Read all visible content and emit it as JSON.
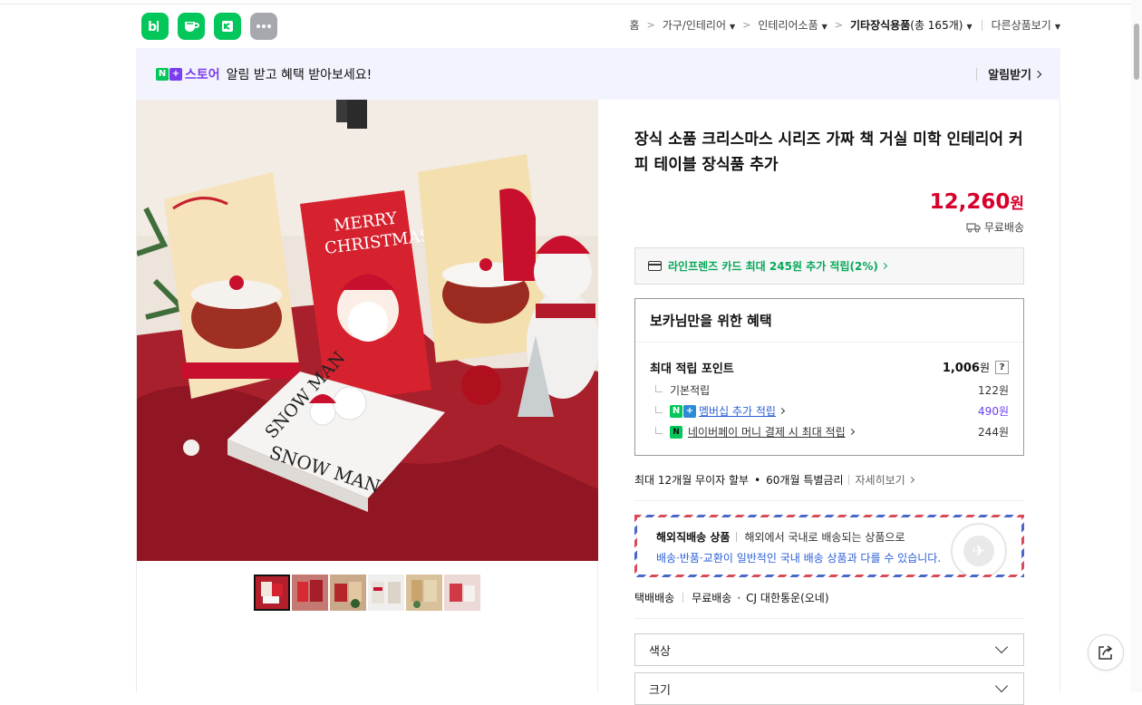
{
  "apps": [
    {
      "name": "blog",
      "label": "b|",
      "color": "#03c75a"
    },
    {
      "name": "cafe",
      "label": "",
      "color": "#03c75a"
    },
    {
      "name": "news",
      "label": "",
      "color": "#03c75a"
    },
    {
      "name": "more",
      "label": "···",
      "color": "#a6a8ae"
    }
  ],
  "breadcrumb": {
    "home": "홈",
    "c1": "가구/인테리어",
    "c2": "인테리어소품",
    "c3": "기타장식용품",
    "c3_count": "(총 165개)",
    "other": "다른상품보기"
  },
  "banner": {
    "store": "스토어",
    "message": "알림 받고 혜택 받아보세요!",
    "action": "알림받기"
  },
  "product": {
    "title": "장식 소품 크리스마스 시리즈 가짜 책 거실 미학 인테리어 커피 테이블 장식품 추가",
    "price": "12,260",
    "currency": "원",
    "shipping": "무료배송"
  },
  "card_benefit": "라인프렌즈 카드 최대 245원 추가 적립(2%)",
  "benefits": {
    "title": "보카님만을 위한 혜택",
    "max_label": "최대 적립 포인트",
    "max_value": "1,006",
    "won": "원",
    "help": "?",
    "rows": [
      {
        "label": "기본적립",
        "value": "122원"
      },
      {
        "label": "멤버십 추가 적립",
        "value": "490원"
      },
      {
        "label": "네이버페이 머니 결제 시 최대 적립",
        "value": "244원"
      }
    ]
  },
  "installment": {
    "text1": "최대 12개월 무이자 할부",
    "text2": "60개월 특별금리",
    "more": "자세히보기"
  },
  "overseas": {
    "title": "해외직배송 상품",
    "line1": "해외에서 국내로 배송되는 상품으로",
    "line2": "배송·반품·교환이 일반적인 국내 배송 상품과 다를 수 있습니다."
  },
  "delivery": {
    "type": "택배배송",
    "fee": "무료배송",
    "carrier": "CJ 대한통운(오네)"
  },
  "options": [
    "색상",
    "크기"
  ],
  "colors": {
    "naver_green": "#03c75a",
    "price_red": "#d8002b",
    "store_purple": "#7a3df0",
    "link_blue": "#2c5fd6"
  }
}
